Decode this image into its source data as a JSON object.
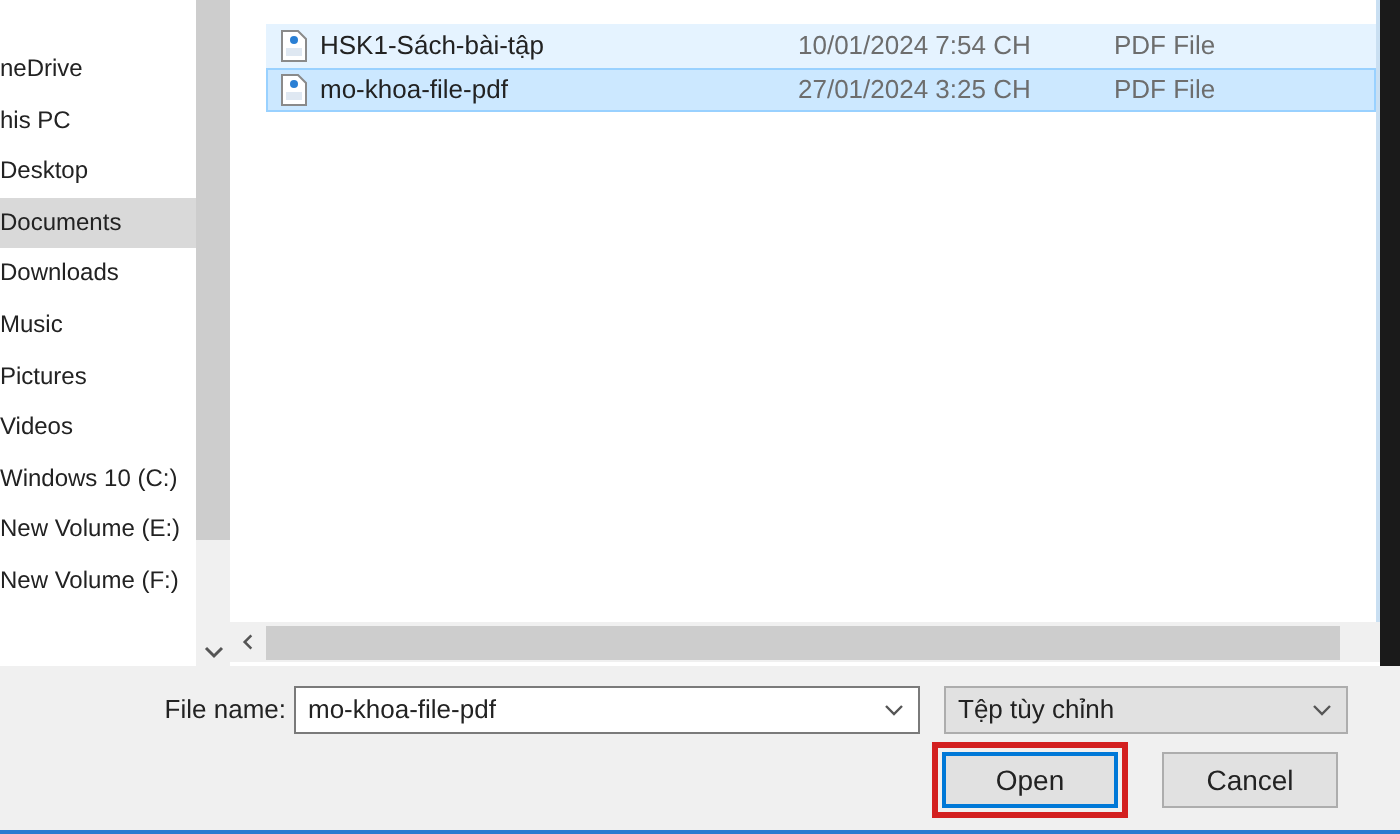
{
  "sidebar": {
    "items": [
      {
        "label": "neDrive",
        "selected": false
      },
      {
        "label": "his PC",
        "selected": false
      },
      {
        "label": "Desktop",
        "selected": false
      },
      {
        "label": "Documents",
        "selected": true
      },
      {
        "label": "Downloads",
        "selected": false
      },
      {
        "label": "Music",
        "selected": false
      },
      {
        "label": "Pictures",
        "selected": false
      },
      {
        "label": "Videos",
        "selected": false
      },
      {
        "label": "Windows 10 (C:)",
        "selected": false
      },
      {
        "label": "New Volume (E:)",
        "selected": false
      },
      {
        "label": "New Volume (F:)",
        "selected": false
      }
    ]
  },
  "files": [
    {
      "name": "HSK1-Sách-bài-tập",
      "date": "10/01/2024 7:54 CH",
      "type": "PDF File",
      "selected": false,
      "hover": true
    },
    {
      "name": "mo-khoa-file-pdf",
      "date": "27/01/2024 3:25 CH",
      "type": "PDF File",
      "selected": true,
      "hover": false
    }
  ],
  "file_name": {
    "label": "File name:",
    "value": "mo-khoa-file-pdf"
  },
  "file_type": {
    "value": "Tệp tùy chỉnh"
  },
  "buttons": [
    {
      "label": "Open",
      "kind": "primary",
      "highlighted": true
    },
    {
      "label": "Cancel",
      "kind": "secondary",
      "highlighted": false
    }
  ]
}
